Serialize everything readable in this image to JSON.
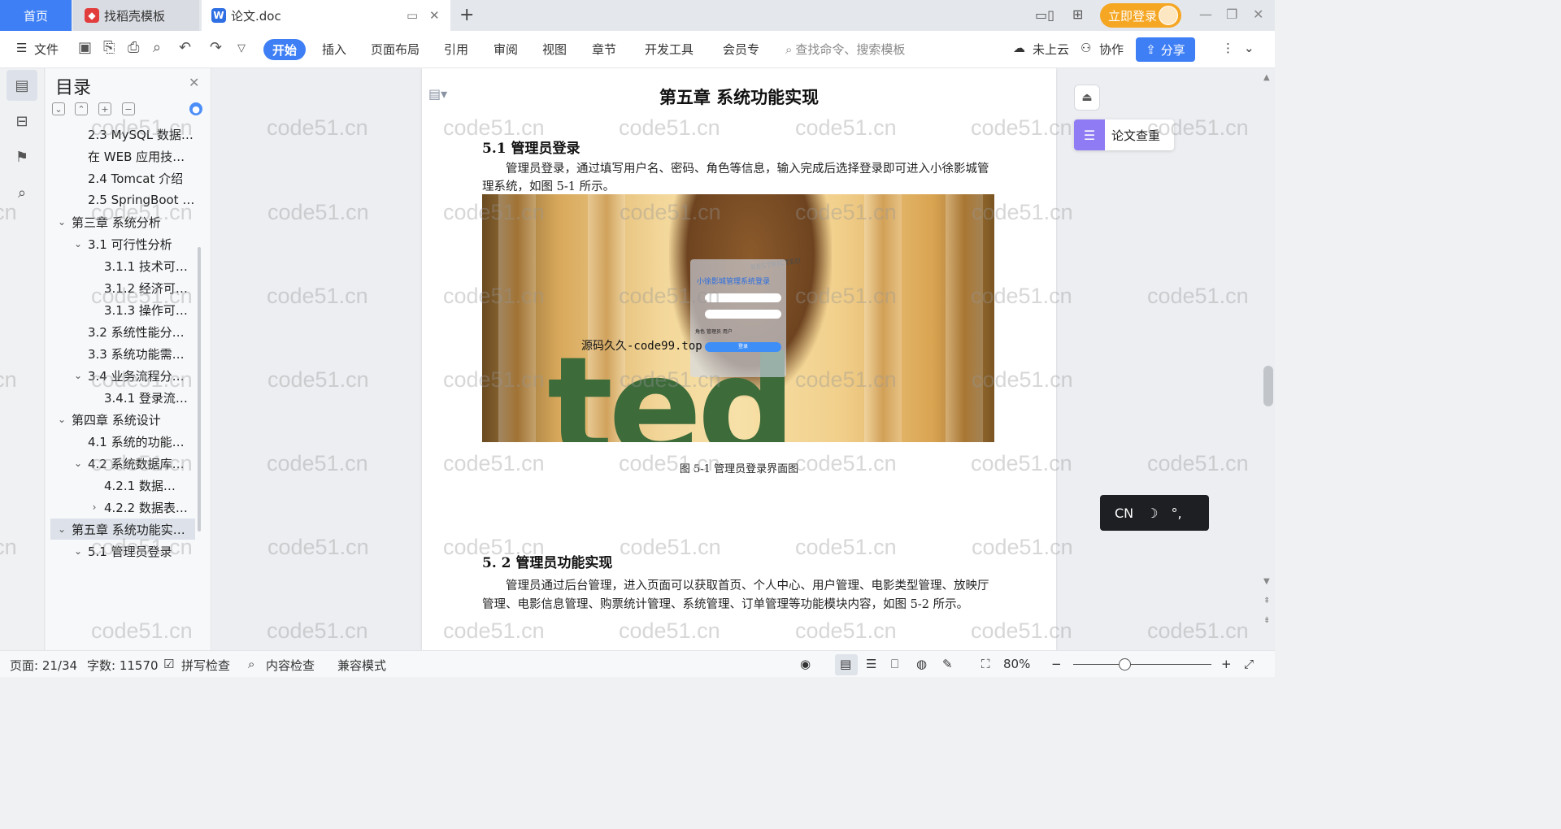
{
  "tabs": {
    "home": "首页",
    "template": "找稻壳模板",
    "doc": "论文.doc"
  },
  "account": {
    "login_label": "立即登录"
  },
  "menu": {
    "file": "文件",
    "active": "开始",
    "items": [
      "插入",
      "页面布局",
      "引用",
      "审阅",
      "视图",
      "章节",
      "开发工具",
      "会员专"
    ],
    "search_placeholder": "查找命令、搜索模板",
    "cloud": "未上云",
    "collab": "协作",
    "share": "分享"
  },
  "toc": {
    "title": "目录",
    "items": [
      {
        "label": "2.3 MySQL 数据…",
        "level": 2,
        "caret": ""
      },
      {
        "label": "在 WEB 应用技…",
        "level": 2,
        "caret": ""
      },
      {
        "label": "2.4 Tomcat 介绍",
        "level": 2,
        "caret": ""
      },
      {
        "label": "2.5 SpringBoot …",
        "level": 2,
        "caret": ""
      },
      {
        "label": "第三章  系统分析",
        "level": 1,
        "caret": "v"
      },
      {
        "label": "3.1  可行性分析",
        "level": 2,
        "caret": "v"
      },
      {
        "label": "3.1.1    技术可…",
        "level": 3,
        "caret": ""
      },
      {
        "label": "3.1.2  经济可…",
        "level": 3,
        "caret": ""
      },
      {
        "label": "3.1.3  操作可…",
        "level": 3,
        "caret": ""
      },
      {
        "label": "3.2  系统性能分…",
        "level": 2,
        "caret": ""
      },
      {
        "label": "3.3  系统功能需…",
        "level": 2,
        "caret": ""
      },
      {
        "label": "3.4  业务流程分…",
        "level": 2,
        "caret": "v"
      },
      {
        "label": "3.4.1 登录流…",
        "level": 3,
        "caret": ""
      },
      {
        "label": "第四章  系统设计",
        "level": 1,
        "caret": "v"
      },
      {
        "label": "4.1  系统的功能…",
        "level": 2,
        "caret": ""
      },
      {
        "label": "4.2  系统数据库…",
        "level": 2,
        "caret": "v"
      },
      {
        "label": "4.2.1    数据…",
        "level": 3,
        "caret": ""
      },
      {
        "label": "4.2.2    数据表…",
        "level": 3,
        "caret": ">"
      },
      {
        "label": "第五章  系统功能实…",
        "level": 1,
        "caret": "v",
        "selected": true
      },
      {
        "label": "5.1 管理员登录",
        "level": 2,
        "caret": "v"
      }
    ]
  },
  "document": {
    "chapter_title": "第五章  系统功能实现",
    "section1_title": "5.1 管理员登录",
    "section1_para": "管理员登录，通过填写用户名、密码、角色等信息，输入完成后选择登录即可进入小徐影城管理系统，如图 5-1 所示。",
    "figure": {
      "login_title": "小徐影城管理系统登录",
      "role_label": "角色",
      "role_options": "管理员   用户",
      "login_button": "登录",
      "watermark_text": "源码久久-code99.top",
      "sign_text": "RESTRICTED"
    },
    "figure_caption": "图 5-1 管理员登录界面图",
    "section2_title": "5. 2 管理员功能实现",
    "section2_para": "管理员通过后台管理，进入页面可以获取首页、个人中心、用户管理、电影类型管理、放映厅管理、电影信息管理、购票统计管理、系统管理、订单管理等功能模块内容，如图 5-2 所示。"
  },
  "right_panel": {
    "plagiarism_label": "论文查重",
    "ime": {
      "lang": "CN",
      "moon": "☽",
      "punct": "°,"
    }
  },
  "watermark": "code51.cn",
  "statusbar": {
    "page": "页面: 21/34",
    "words": "字数: 11570",
    "spell": "拼写检查",
    "content_check": "内容检查",
    "compat": "兼容模式",
    "zoom": "80%"
  },
  "colors": {
    "accent": "#3e7ff5",
    "login_orange": "#f5a623",
    "plagiarism_purple": "#8f7cf4"
  }
}
